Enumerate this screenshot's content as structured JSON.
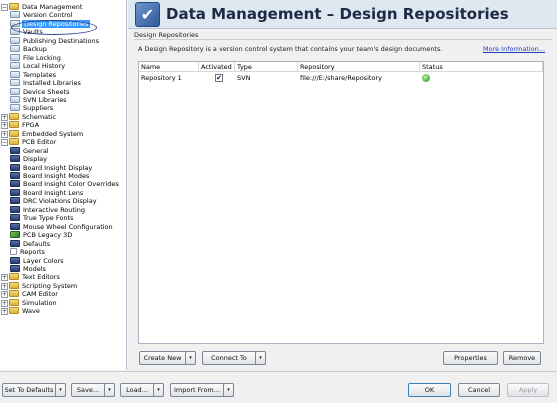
{
  "header": {
    "title": "Data Management – Design Repositories"
  },
  "tree": {
    "items": [
      {
        "label": "Data Management",
        "indent": 0,
        "expander": "−",
        "icon": "folder-icon",
        "icon_class": "folder"
      },
      {
        "label": "Version Control",
        "indent": 1,
        "icon": "page-icon",
        "icon_class": "page"
      },
      {
        "label": "Design Repositories",
        "indent": 1,
        "icon": "page-icon",
        "icon_class": "page",
        "selected": true
      },
      {
        "label": "Vaults",
        "indent": 1,
        "icon": "page-icon",
        "icon_class": "page"
      },
      {
        "label": "Publishing Destinations",
        "indent": 1,
        "icon": "page-icon",
        "icon_class": "page"
      },
      {
        "label": "Backup",
        "indent": 1,
        "icon": "page-icon",
        "icon_class": "page"
      },
      {
        "label": "File Locking",
        "indent": 1,
        "icon": "page-icon",
        "icon_class": "page"
      },
      {
        "label": "Local History",
        "indent": 1,
        "icon": "page-icon",
        "icon_class": "page"
      },
      {
        "label": "Templates",
        "indent": 1,
        "icon": "page-icon",
        "icon_class": "page"
      },
      {
        "label": "Installed Libraries",
        "indent": 1,
        "icon": "page-icon",
        "icon_class": "page"
      },
      {
        "label": "Device Sheets",
        "indent": 1,
        "icon": "page-icon",
        "icon_class": "page"
      },
      {
        "label": "SVN Libraries",
        "indent": 1,
        "icon": "page-icon",
        "icon_class": "page"
      },
      {
        "label": "Suppliers",
        "indent": 1,
        "icon": "page-icon",
        "icon_class": "page"
      },
      {
        "label": "Schematic",
        "indent": 0,
        "expander": "+",
        "icon": "folder-icon",
        "icon_class": "folder"
      },
      {
        "label": "FPGA",
        "indent": 0,
        "expander": "+",
        "icon": "folder-icon",
        "icon_class": "folder"
      },
      {
        "label": "Embedded System",
        "indent": 0,
        "expander": "+",
        "icon": "folder-icon",
        "icon_class": "folder"
      },
      {
        "label": "PCB Editor",
        "indent": 0,
        "expander": "−",
        "icon": "folder-icon",
        "icon_class": "folder"
      },
      {
        "label": "General",
        "indent": 1,
        "icon": "pcb-icon",
        "icon_class": "pcb"
      },
      {
        "label": "Display",
        "indent": 1,
        "icon": "pcb-icon",
        "icon_class": "pcb"
      },
      {
        "label": "Board Insight Display",
        "indent": 1,
        "icon": "pcb-icon",
        "icon_class": "pcb"
      },
      {
        "label": "Board Insight Modes",
        "indent": 1,
        "icon": "pcb-icon",
        "icon_class": "pcb"
      },
      {
        "label": "Board Insight Color Overrides",
        "indent": 1,
        "icon": "pcb-icon",
        "icon_class": "pcb"
      },
      {
        "label": "Board Insight Lens",
        "indent": 1,
        "icon": "pcb-icon",
        "icon_class": "pcb"
      },
      {
        "label": "DRC Violations Display",
        "indent": 1,
        "icon": "pcb-icon",
        "icon_class": "pcb"
      },
      {
        "label": "Interactive Routing",
        "indent": 1,
        "icon": "pcb-icon",
        "icon_class": "pcb"
      },
      {
        "label": "True Type Fonts",
        "indent": 1,
        "icon": "pcb-icon",
        "icon_class": "pcb"
      },
      {
        "label": "Mouse Wheel Configuration",
        "indent": 1,
        "icon": "pcb-icon",
        "icon_class": "pcb"
      },
      {
        "label": "PCB Legacy 3D",
        "indent": 1,
        "icon": "3d-icon",
        "icon_class": "ico3d"
      },
      {
        "label": "Defaults",
        "indent": 1,
        "icon": "pcb-icon",
        "icon_class": "pcb"
      },
      {
        "label": "Reports",
        "indent": 1,
        "icon": "document-icon",
        "icon_class": "doc"
      },
      {
        "label": "Layer Colors",
        "indent": 1,
        "icon": "pcb-icon",
        "icon_class": "pcb"
      },
      {
        "label": "Models",
        "indent": 1,
        "icon": "pcb-icon",
        "icon_class": "pcb"
      },
      {
        "label": "Text Editors",
        "indent": 0,
        "expander": "+",
        "icon": "folder-icon",
        "icon_class": "folder"
      },
      {
        "label": "Scripting System",
        "indent": 0,
        "expander": "+",
        "icon": "folder-icon",
        "icon_class": "folder"
      },
      {
        "label": "CAM Editor",
        "indent": 0,
        "expander": "+",
        "icon": "folder-icon",
        "icon_class": "folder"
      },
      {
        "label": "Simulation",
        "indent": 0,
        "expander": "+",
        "icon": "folder-icon",
        "icon_class": "folder"
      },
      {
        "label": "Wave",
        "indent": 0,
        "expander": "+",
        "icon": "folder-icon",
        "icon_class": "folder"
      }
    ]
  },
  "panel": {
    "group_label": "Design Repositories",
    "description": "A Design Repository is a version control system that contains your team's design documents.",
    "more_link": "More Information..."
  },
  "table": {
    "columns": [
      "Name",
      "Activated",
      "Type",
      "Repository",
      "Status"
    ],
    "rows": [
      {
        "name": "Repository 1",
        "activated": true,
        "activated_mark": "✔",
        "type": "SVN",
        "repository": "file:///E:/share/Repository",
        "status": "ok-icon",
        "status_mark": "✓"
      }
    ]
  },
  "panel_buttons": {
    "create_new": "Create New",
    "connect_to": "Connect To",
    "properties": "Properties",
    "remove": "Remove",
    "dropdown_glyph": "▾"
  },
  "footer": {
    "set_to_defaults": "Set To Defaults",
    "save": "Save...",
    "load": "Load...",
    "import_from": "Import From...",
    "ok": "OK",
    "cancel": "Cancel",
    "apply": "Apply"
  },
  "colors": {
    "selection": "#3399ff",
    "header_bg": "#dfe7f1",
    "link": "#1f3fbf",
    "annotation_oval": "#2c3f8c"
  }
}
